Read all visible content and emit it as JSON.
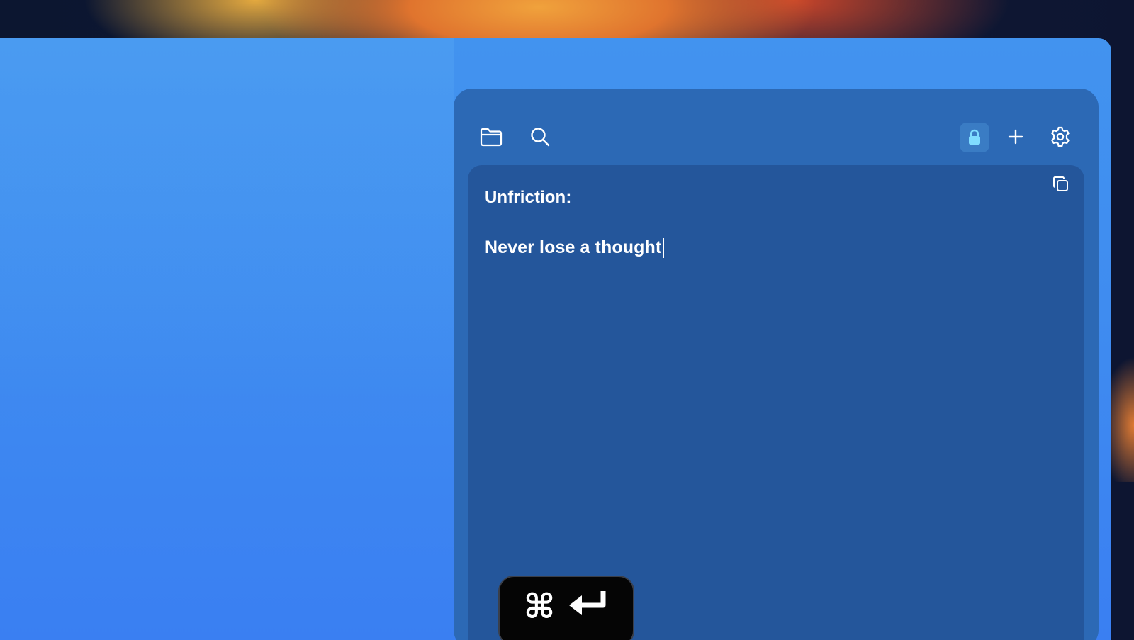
{
  "toolbar": {
    "icons": {
      "folder": "folder-icon",
      "search": "search-icon",
      "lock": "lock-icon",
      "add": "plus-icon",
      "settings": "gear-icon"
    },
    "lock_active_color": "#7fdcff"
  },
  "editor": {
    "title": "Unfriction:",
    "body": "Never lose a thought",
    "copy_icon": "copy-icon"
  },
  "shortcut": {
    "command_symbol": "⌘",
    "return_symbol": "↵"
  },
  "colors": {
    "window_blue": "#3f8cf0",
    "panel": "#2c69b5",
    "editor": "#24569b"
  }
}
